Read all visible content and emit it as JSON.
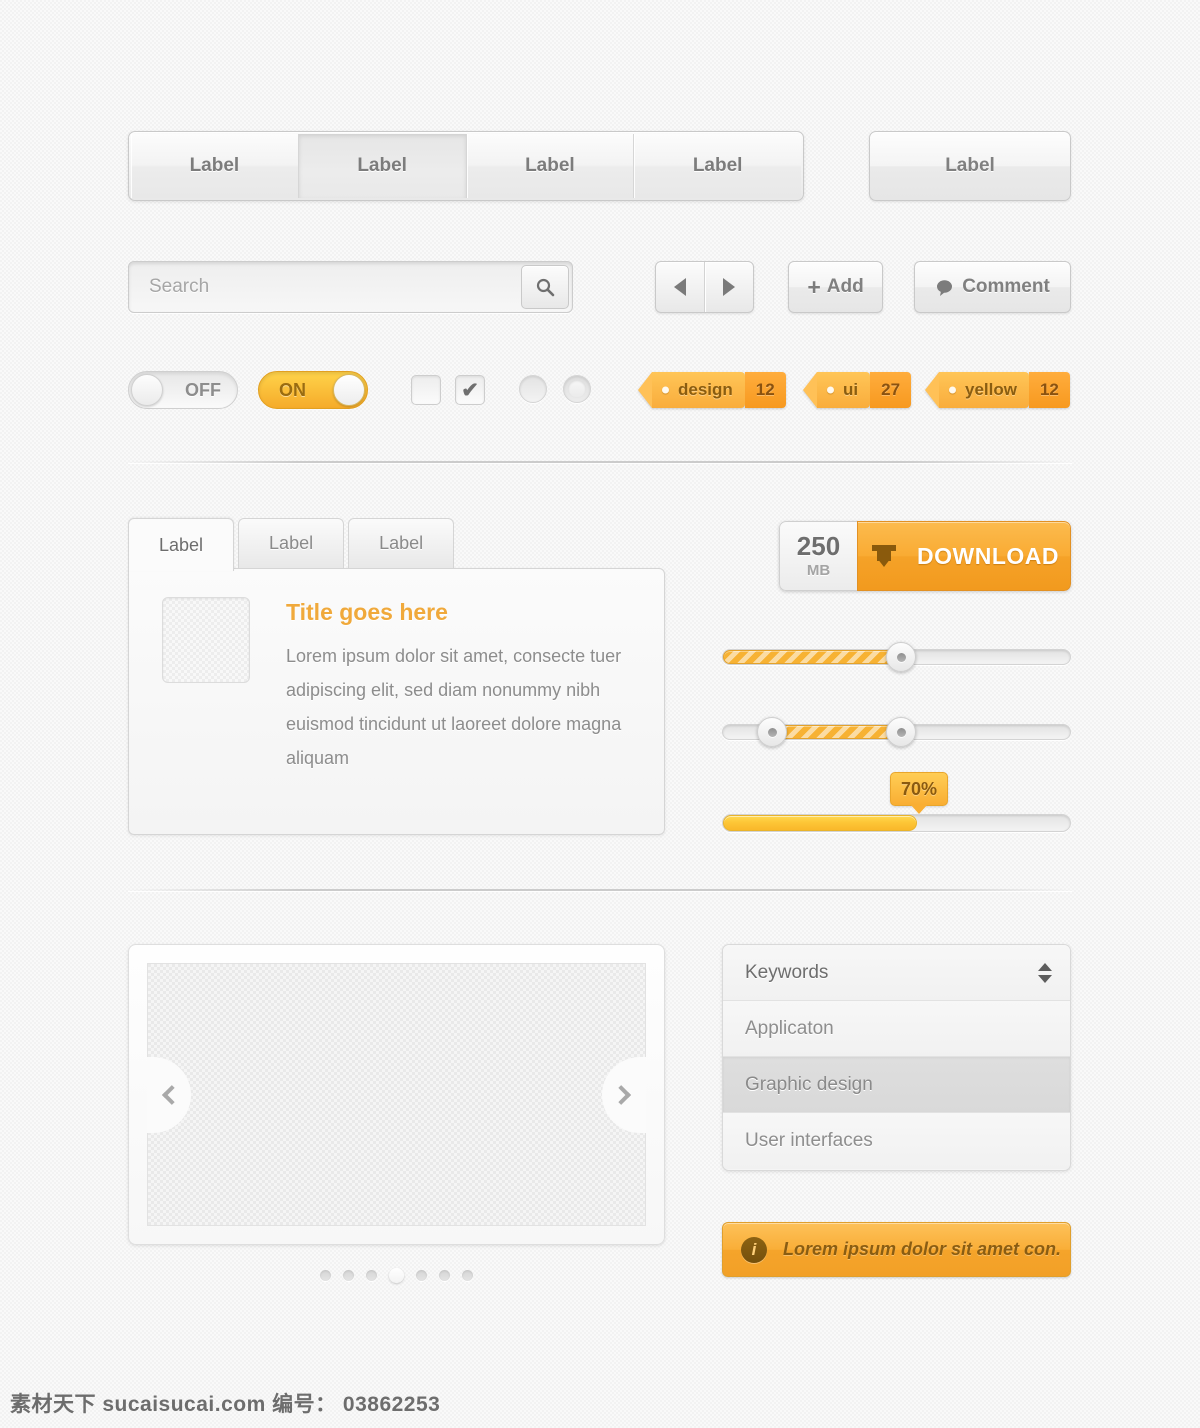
{
  "segmented_group": {
    "items": [
      {
        "label": "Label",
        "active": false
      },
      {
        "label": "Label",
        "active": true
      },
      {
        "label": "Label",
        "active": false
      },
      {
        "label": "Label",
        "active": false
      }
    ]
  },
  "single_button": {
    "label": "Label"
  },
  "search": {
    "value": "",
    "placeholder": "Search",
    "icon": "search-icon"
  },
  "nav_arrows": {
    "prev_icon": "triangle-left-icon",
    "next_icon": "triangle-right-icon"
  },
  "add_button": {
    "label": "Add",
    "icon": "plus-icon"
  },
  "comment_button": {
    "label": "Comment",
    "icon": "speech-bubble-icon"
  },
  "toggles": {
    "off": {
      "label": "OFF",
      "state": "off"
    },
    "on": {
      "label": "ON",
      "state": "on"
    }
  },
  "checkboxes": [
    {
      "checked": false,
      "mark": ""
    },
    {
      "checked": true,
      "mark": "✔"
    }
  ],
  "tags": [
    {
      "label": "design",
      "count": "12"
    },
    {
      "label": "ui",
      "count": "27"
    },
    {
      "label": "yellow",
      "count": "12"
    }
  ],
  "tab_panel": {
    "tabs": [
      {
        "label": "Label",
        "active": true
      },
      {
        "label": "Label",
        "active": false
      },
      {
        "label": "Label",
        "active": false
      }
    ],
    "title": "Title goes here",
    "body": "Lorem ipsum dolor sit amet, consecte tuer adipiscing elit, sed diam nonummy nibh euismod tincidunt ut laoreet dolore magna aliquam"
  },
  "download": {
    "size_number": "250",
    "size_unit": "MB",
    "label": "DOWNLOAD",
    "icon": "download-tray-icon"
  },
  "sliders": [
    {
      "name": "single-handle-slider",
      "fill_start_pct": 0,
      "fill_end_pct": 51,
      "handles_pct": [
        51
      ]
    },
    {
      "name": "range-slider",
      "fill_start_pct": 14,
      "fill_end_pct": 51,
      "handles_pct": [
        14,
        51
      ]
    }
  ],
  "progress": {
    "value_label": "70%",
    "value_pct": 70
  },
  "carousel": {
    "prev_icon": "chevron-left-icon",
    "next_icon": "chevron-right-icon",
    "dots": [
      false,
      false,
      false,
      true,
      false,
      false,
      false
    ]
  },
  "listbox": {
    "rows": [
      {
        "label": "Keywords",
        "header": true,
        "selected": false,
        "stepper": true
      },
      {
        "label": "Applicaton",
        "header": false,
        "selected": false,
        "stepper": false
      },
      {
        "label": "Graphic design",
        "header": false,
        "selected": true,
        "stepper": false
      },
      {
        "label": "User interfaces",
        "header": false,
        "selected": false,
        "stepper": false
      }
    ]
  },
  "notification": {
    "icon_glyph": "i",
    "icon": "info-icon",
    "text": "Lorem ipsum dolor sit amet con."
  },
  "watermark": {
    "text": "素材天下 sucaisucai.com  编号： 03862253"
  },
  "colors": {
    "accent_orange": "#f9ae33",
    "accent_orange_dark": "#f7991f",
    "accent_yellow": "#ffd34a",
    "tag_text": "#8a5d10",
    "title_orange": "#f0a93b",
    "body_text": "#8d8d8d",
    "background": "#f2f2f2"
  }
}
